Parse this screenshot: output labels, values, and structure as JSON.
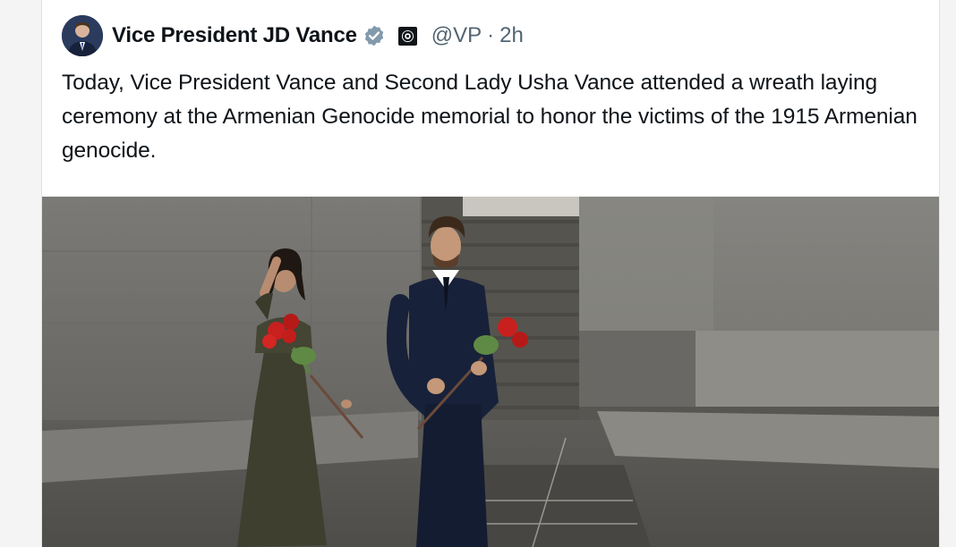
{
  "post": {
    "author_name": "Vice President JD Vance",
    "handle": "@VP",
    "separator": "·",
    "time_ago": "2h",
    "text": "Today, Vice President Vance and Second Lady Usha Vance attended a wreath laying ceremony at the Armenian Genocide memorial to honor the victims of the 1915 Armenian genocide."
  },
  "icons": {
    "avatar": "avatar",
    "verified": "verified-badge-icon",
    "affiliation": "government-seal-badge-icon"
  },
  "colors": {
    "verified_badge": "#829aab",
    "text_primary": "#0f1419",
    "text_secondary": "#536471",
    "roses": "#c8201e"
  }
}
